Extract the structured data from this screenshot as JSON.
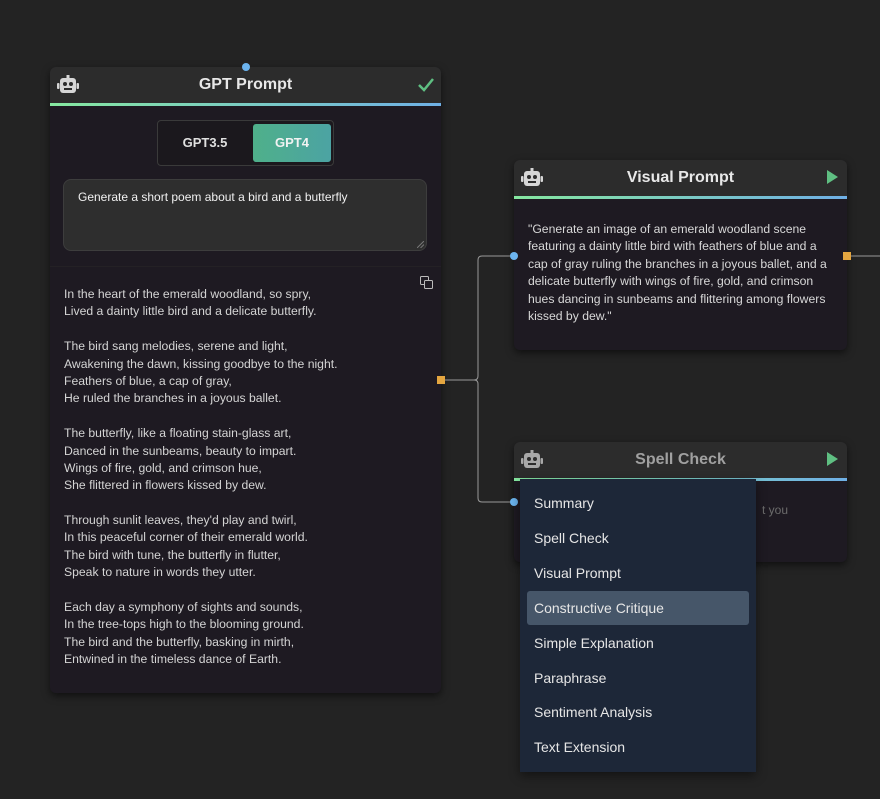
{
  "gpt_node": {
    "title": "GPT Prompt",
    "models": [
      "GPT3.5",
      "GPT4"
    ],
    "selected_model": "GPT4",
    "prompt": "Generate a short poem about a bird and a butterfly",
    "output_lines": [
      "In the heart of the emerald woodland, so spry,",
      "Lived a dainty little bird and a delicate butterfly.",
      "",
      "The bird sang melodies, serene and light,",
      "Awakening the dawn, kissing goodbye to the night.",
      "Feathers of blue, a cap of gray,",
      "He ruled the branches in a joyous ballet.",
      "",
      "The butterfly, like a floating stain-glass art,",
      "Danced in the sunbeams, beauty to impart.",
      "Wings of fire, gold, and crimson hue,",
      "She flittered in flowers kissed by dew.",
      "",
      "Through sunlit leaves, they'd play and twirl,",
      "In this peaceful corner of their emerald world.",
      "The bird with tune, the butterfly in flutter,",
      "Speak to nature in words they utter.",
      "",
      "Each day a symphony of sights and sounds,",
      "In the tree-tops high to the blooming ground.",
      "The bird and the butterfly, basking in mirth,",
      "Entwined in the timeless dance of Earth."
    ],
    "status_icon": "check-icon"
  },
  "visual_node": {
    "title": "Visual Prompt",
    "text": "\"Generate an image of an emerald woodland scene featuring a dainty little bird with feathers of blue and a cap of gray ruling the branches in a joyous ballet, and a delicate butterfly with wings of fire, gold, and crimson hues dancing in sunbeams and flittering among flowers kissed by dew.\"",
    "run_icon": "play-icon"
  },
  "spell_node": {
    "title": "Spell Check",
    "partial_text": "t you",
    "run_icon": "play-icon"
  },
  "dropdown": {
    "items": [
      "Summary",
      "Spell Check",
      "Visual Prompt",
      "Constructive Critique",
      "Simple Explanation",
      "Paraphrase",
      "Sentiment Analysis",
      "Text Extension"
    ],
    "highlighted": "Constructive Critique"
  },
  "colors": {
    "background": "#232323",
    "node_body": "#1e1a22",
    "node_header": "#2c2c2c",
    "accent_green": "#86e8a0",
    "accent_blue": "#6fb0e6",
    "target_handle": "#6cb4ef",
    "source_handle": "#e4a640",
    "dropdown_bg": "#1d2738",
    "dropdown_highlight": "#465669"
  }
}
